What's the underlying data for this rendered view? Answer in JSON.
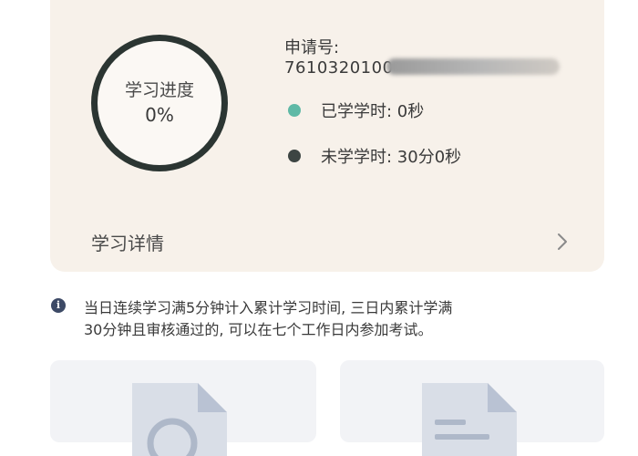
{
  "progress": {
    "label": "学习进度",
    "value": "0%"
  },
  "application": {
    "label": "申请号:",
    "number_visible": "7610320100"
  },
  "stats": {
    "learned": "已学学时: 0秒",
    "remaining": "未学学时: 30分0秒"
  },
  "details": {
    "label": "学习详情"
  },
  "notice": {
    "line1": "当日连续学习满5分钟计入累计学习时间, 三日内累计学满",
    "line2": "30分钟且审核通过的, 可以在七个工作日内参加考试。"
  },
  "icons": {
    "info": "info-icon",
    "chevron": "chevron-right-icon",
    "document": "document-icon"
  },
  "colors": {
    "card_bg": "#f7f1ea",
    "ring": "#2b3532",
    "learned_dot": "#5fb9a6",
    "remaining_dot": "#3d4543",
    "info_icon": "#3d4a66"
  }
}
